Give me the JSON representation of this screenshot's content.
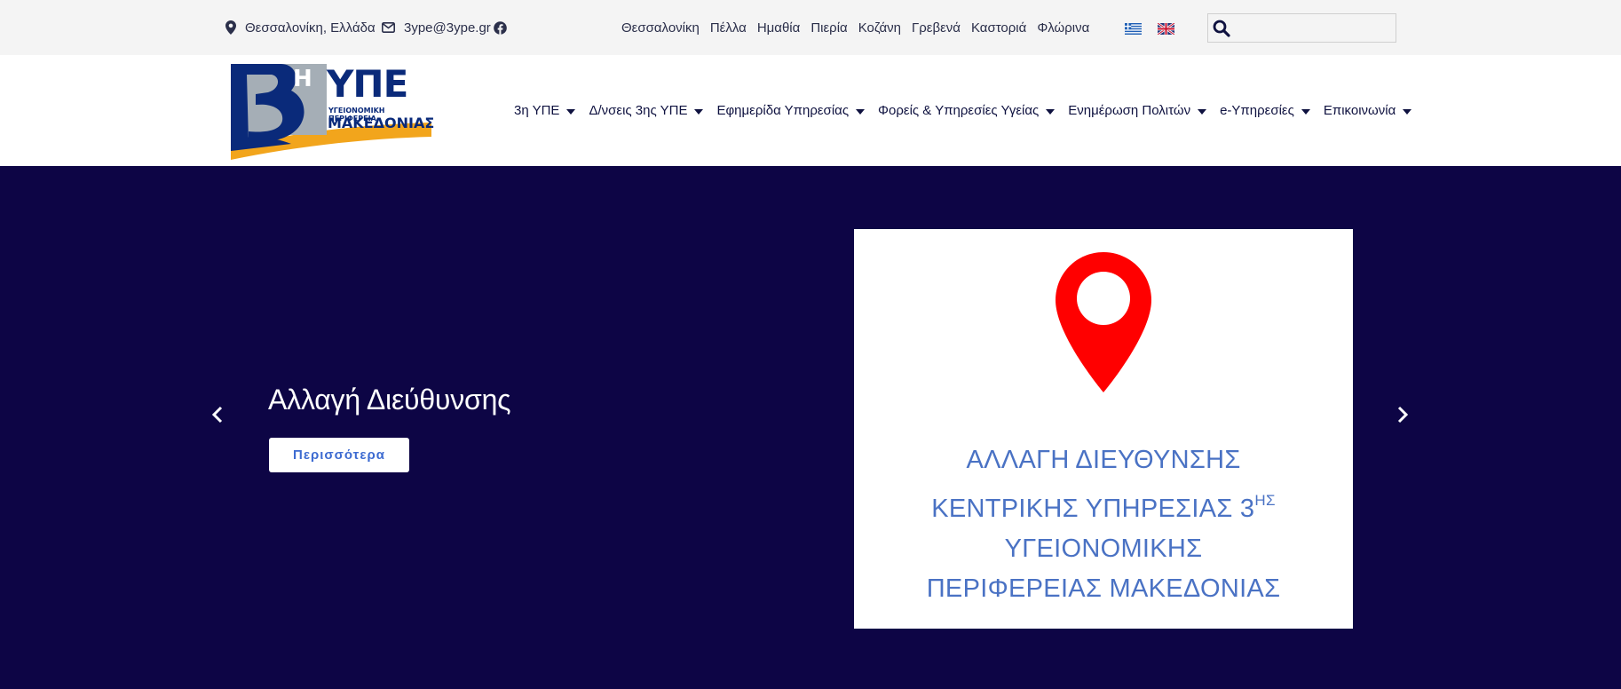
{
  "topbar": {
    "location": "Θεσσαλονίκη, Ελλάδα",
    "email": "3ype@3ype.gr",
    "regions": [
      "Θεσσαλονίκη",
      "Πέλλα",
      "Ημαθία",
      "Πιερία",
      "Κοζάνη",
      "Γρεβενά",
      "Καστοριά",
      "Φλώρινα"
    ],
    "search_placeholder": ""
  },
  "logo": {
    "number": "3",
    "superscript": "Η",
    "acronym": "ΥΠΕ",
    "line1": "ΥΓΕΙΟΝΟΜΙΚΗ ΠΕΡΙΦΕΡΕΙΑ",
    "line2": "ΜΑΚΕΔΟΝΙΑΣ"
  },
  "nav": {
    "items": [
      "3η ΥΠΕ",
      "Δ/νσεις 3ης ΥΠΕ",
      "Εφημερίδα Υπηρεσίας",
      "Φορείς & Υπηρεσίες Υγείας",
      "Ενημέρωση Πολιτών",
      "e-Υπηρεσίες",
      "Επικοινωνία"
    ]
  },
  "hero": {
    "title": "Αλλαγή Διεύθυνσης",
    "button_label": "Περισσότερα",
    "image_caption": {
      "line1": "ΑΛΛΑΓΗ ΔΙΕΥΘΥΝΣΗΣ",
      "line2": "ΚΕΝΤΡΙΚΗΣ ΥΠΗΡΕΣΙΑΣ 3",
      "line2_sup": "ΗΣ",
      "line3": "ΥΓΕΙΟΝΟΜΙΚΗΣ",
      "line4": "ΠΕΡΙΦΕΡΕΙΑΣ ΜΑΚΕΔΟΝΙΑΣ"
    }
  },
  "colors": {
    "hero_bg": "#0d0545",
    "logo_blue": "#0a2a7a",
    "logo_gray": "#a5aeb6",
    "logo_orange": "#f2a51c",
    "pin_red": "#ff0000",
    "caption_blue": "#4a72c4"
  },
  "icons": [
    "map-pin-icon",
    "envelope-icon",
    "facebook-icon",
    "greek-flag-icon",
    "uk-flag-icon",
    "search-icon",
    "chevron-left-icon",
    "chevron-right-icon",
    "location-pin-icon"
  ]
}
